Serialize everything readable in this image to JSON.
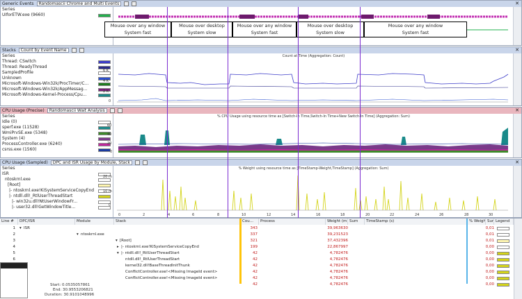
{
  "panel1": {
    "title": "Generic Events",
    "selector": "Randomascii Chrome and Multi Events",
    "series_title": "Series",
    "series": [
      {
        "label": "UIforETW.exe (9660)",
        "color": "#22b14c"
      }
    ],
    "events": [
      {
        "text": "Mouse over any window",
        "sub": "System fast"
      },
      {
        "text": "Mouse over desktop",
        "sub": "System slow"
      },
      {
        "text": "Mouse over any window",
        "sub": "System fast"
      },
      {
        "text": "Mouse over desktop",
        "sub": "System slow"
      },
      {
        "text": "Mouse over any window",
        "sub": "System fast"
      }
    ]
  },
  "panel2": {
    "title": "Stacks",
    "selector": "Count by Event Name",
    "series_title": "Series",
    "chart_title": "Count at Time (Aggregation: Count)",
    "series": [
      {
        "label": "Thread: CSwitch",
        "color": "#3b3bc8"
      },
      {
        "label": "Thread: ReadyThread",
        "color": "#2a2a8a"
      },
      {
        "label": "SampledProfile",
        "color": "#ffffff"
      },
      {
        "label": "Unknown",
        "color": "#2a4fd0"
      },
      {
        "label": "Microsoft-Windows-Win32k/ProcTimer/C...",
        "color": "#1e7a1e"
      },
      {
        "label": "Microsoft-Windows-Win32k/AppMessag...",
        "color": "#7a1e7a"
      },
      {
        "label": "Microsoft-Windows-Kernel-Process/Cpu...",
        "color": "#1a8a8a"
      }
    ],
    "y_ticks": [
      "6 K",
      "4 K",
      "2 K",
      "0"
    ]
  },
  "panel3": {
    "title": "CPU Usage (Precise)",
    "selector": "Randomascii Wait Analysis",
    "series_title": "Series",
    "chart_title": "% CPU Usage using resource time as [Switch-In Time,Switch-In Time+New Switch-In Time] (Aggregation: Sum)",
    "series": [
      {
        "label": "Idle (0)",
        "color": "#ffffff"
      },
      {
        "label": "sperf.exe (11528)",
        "color": "#1a8a8a"
      },
      {
        "label": "WmiPrvSE.exe (5348)",
        "color": "#3e8a2a"
      },
      {
        "label": "System (4)",
        "color": "#7a3a8a"
      },
      {
        "label": "ProcessController.exe (6240)",
        "color": "#c0279c"
      },
      {
        "label": "csrss.exe (1560)",
        "color": "#1a3aa0"
      }
    ],
    "y_ticks": [
      "60",
      "40",
      "20",
      "0"
    ]
  },
  "panel4": {
    "title": "CPU Usage (Sampled)",
    "selector": "DPC and ISR Usage by Module, Stack",
    "series_title": "Series",
    "chart_title": "% Weight using resource time as [TimeStamp-Weight,TimeStamp] (Aggregation: Sum)",
    "series": [
      {
        "label": "ISR",
        "color": "#ffffff"
      },
      {
        "label": "ntoskrnl.exe",
        "color": "#ffffff"
      },
      {
        "label": "[Root]",
        "color": "#fff6b0"
      },
      {
        "label": "|- ntoskrnl.exe!KiSystemServiceCopyEnd",
        "color": "#ffffff"
      },
      {
        "label": "|- ntdll.dll!_RtlUserThreadStart",
        "color": "#d4d41a"
      },
      {
        "label": "|- win32u.dll!NtUserWindowFr...",
        "color": "#ffffff"
      },
      {
        "label": "|- user32.dll!GetWindowTitle...",
        "color": "#ffffff"
      }
    ],
    "y_ticks": [
      "20 m",
      "10 m",
      "0"
    ]
  },
  "x_ticks": [
    "0",
    "2",
    "4",
    "6",
    "8",
    "10",
    "12",
    "14",
    "16",
    "18",
    "20",
    "22",
    "24",
    "26",
    "28",
    "30"
  ],
  "table": {
    "columns": [
      "Line #",
      "DPC/ISR",
      "Module",
      "Stack",
      "Cou...",
      "Process",
      "Weight (m...",
      "Sum",
      "TimeStamp (s)",
      "% Weight",
      "Sum",
      "Legend"
    ],
    "rows": [
      {
        "line": "1",
        "dpc": "ISR",
        "module": "",
        "stack": "",
        "count": "343",
        "weight": "39,963630",
        "pct": "0,01",
        "color": "#ffffff"
      },
      {
        "line": "2",
        "dpc": "",
        "module": "ntoskrnl.exe",
        "stack": "",
        "count": "337",
        "weight": "39,231523",
        "pct": "0,01",
        "color": "#ffffff"
      },
      {
        "line": "3",
        "dpc": "",
        "module": "",
        "stack": "[Root]",
        "count": "321",
        "weight": "37,432396",
        "pct": "0,01",
        "color": "#fff6b0"
      },
      {
        "line": "4",
        "dpc": "",
        "module": "",
        "stack": "|- ntoskrnl.exe!KiSystemServiceCopyEnd",
        "count": "199",
        "weight": "22,867997",
        "pct": "0,00",
        "color": "#ffffff"
      },
      {
        "line": "5",
        "dpc": "",
        "module": "",
        "stack": "|- ntdll.dll!_RtlUserThreadStart",
        "count": "42",
        "weight": "4,782476",
        "pct": "0,00",
        "color": "#d4d41a"
      },
      {
        "line": "6",
        "dpc": "",
        "module": "",
        "stack": "ntdll.dll!_RtlUserThreadStart",
        "count": "42",
        "weight": "4,782476",
        "pct": "0,00",
        "color": "#d4d41a"
      },
      {
        "line": "7",
        "dpc": "",
        "module": "",
        "stack": "kernel32.dll!BaseThreadInitThunk",
        "count": "42",
        "weight": "4,782476",
        "pct": "0,00",
        "color": "#d4d41a"
      },
      {
        "line": "8",
        "dpc": "",
        "module": "",
        "stack": "ConflictController.exe!<Missing ImageId event>",
        "count": "42",
        "weight": "4,782476",
        "pct": "0,00",
        "color": "#d4d41a"
      },
      {
        "line": "9",
        "dpc": "",
        "module": "",
        "stack": "ConflictController.exe!<Missing ImageId event>",
        "count": "42",
        "weight": "4,782476",
        "pct": "0,00",
        "color": "#d4d41a"
      },
      {
        "line": "10",
        "dpc": "",
        "module": "",
        "stack": "",
        "count": "42",
        "weight": "4,782476",
        "pct": "0,00",
        "color": "#d4d41a"
      }
    ]
  },
  "footer": {
    "start": "Start:  0.0535057861",
    "end": "End:  30.9553206821",
    "duration": "Duration:  30.9101048996"
  }
}
